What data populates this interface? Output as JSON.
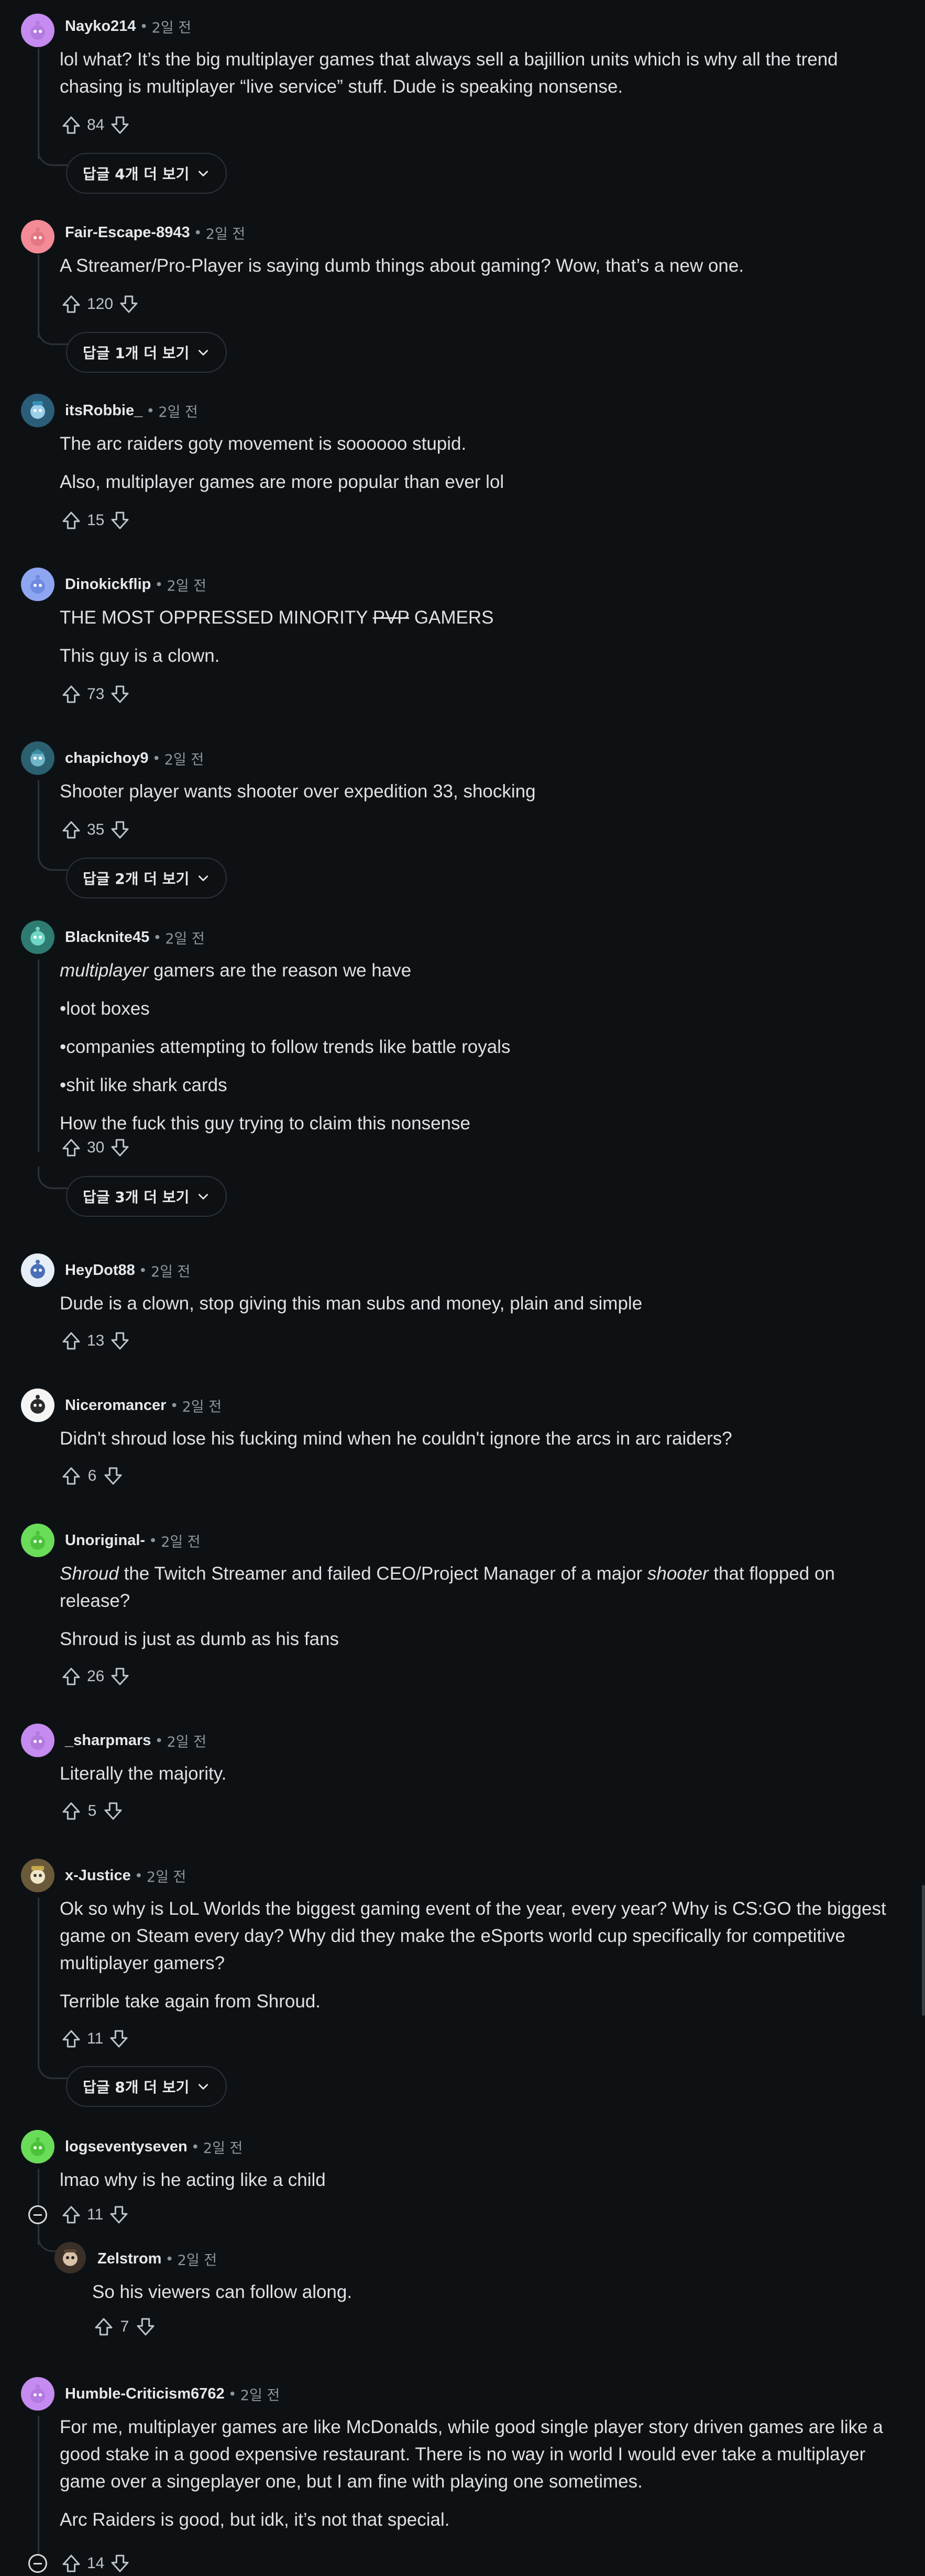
{
  "icons": {
    "upvote": "arrow-up-outline",
    "downvote": "arrow-down-outline",
    "chevron": "chevron-down",
    "collapse": "minus-circle"
  },
  "comments": [
    {
      "user": "Nayko214",
      "time": "2일 전",
      "score": "84",
      "paragraphs": [
        "lol what? It’s the big multiplayer games that always sell a bajillion units which is why all the trend chasing is multiplayer “live service” stuff. Dude is speaking nonsense."
      ],
      "more_replies": "답글 4개 더 보기",
      "avatar_color": "#c58bf0"
    },
    {
      "user": "Fair-Escape-8943",
      "time": "2일 전",
      "score": "120",
      "paragraphs": [
        "A Streamer/Pro-Player is saying dumb things about gaming? Wow, that’s a new one."
      ],
      "more_replies": "답글 1개 더 보기",
      "avatar_color": "#f28b96"
    },
    {
      "user": "itsRobbie_",
      "time": "2일 전",
      "score": "15",
      "paragraphs": [
        "The arc raiders goty movement is soooooo stupid.",
        "Also, multiplayer games are more popular than ever lol"
      ],
      "avatar_color": "#9bd0e8"
    },
    {
      "user": "Dinokickflip",
      "time": "2일 전",
      "score": "73",
      "para1_before": "THE MOST OPPRESSED MINORITY ",
      "para1_strike": "PVP",
      "para1_after": " GAMERS",
      "para2": "This guy is a clown.",
      "avatar_color": "#8ea6f2"
    },
    {
      "user": "chapichoy9",
      "time": "2일 전",
      "score": "35",
      "paragraphs": [
        "Shooter player wants shooter over expedition 33, shocking"
      ],
      "more_replies": "답글 2개 더 보기",
      "avatar_color": "#6fb6c9"
    },
    {
      "user": "Blacknite45",
      "time": "2일 전",
      "score": "30",
      "para1_em": "multiplayer",
      "para1_rest": " gamers are the reason we have",
      "paragraphs": [
        "•loot boxes",
        "•companies attempting to follow trends like battle royals",
        "•shit like shark cards",
        "How the fuck this guy trying to claim this nonsense"
      ],
      "more_replies": "답글 3개 더 보기",
      "avatar_color": "#6fd5c4"
    },
    {
      "user": "HeyDot88",
      "time": "2일 전",
      "score": "13",
      "paragraphs": [
        "Dude is a clown, stop giving this man subs and money, plain and simple"
      ],
      "avatar_color": "#e8eef8"
    },
    {
      "user": "Niceromancer",
      "time": "2일 전",
      "score": "6",
      "paragraphs": [
        "Didn't shroud lose his fucking mind when he couldn't ignore the arcs in arc raiders?"
      ],
      "avatar_color": "#f4f4f4"
    },
    {
      "user": "Unoriginal-",
      "time": "2일 전",
      "score": "26",
      "p1_em1": "Shroud",
      "p1_mid": " the Twitch Streamer and failed CEO/Project Manager of a major ",
      "p1_em2": "shooter",
      "p1_end": " that flopped on release?",
      "para2": "Shroud is just as dumb as his fans",
      "avatar_color": "#6bdc5a"
    },
    {
      "user": "_sharpmars",
      "time": "2일 전",
      "score": "5",
      "paragraphs": [
        "Literally the majority."
      ],
      "avatar_color": "#c58bf0"
    },
    {
      "user": "x-Justice",
      "time": "2일 전",
      "score": "11",
      "paragraphs": [
        "Ok so why is LoL Worlds the biggest gaming event of the year, every year? Why is CS:GO the biggest game on Steam every day? Why did they make the eSports world cup specifically for competitive multiplayer gamers?",
        "Terrible take again from Shroud."
      ],
      "more_replies": "답글 8개 더 보기",
      "avatar_color": "#f0e6c8"
    },
    {
      "user": "logseventyseven",
      "time": "2일 전",
      "score": "11",
      "paragraphs": [
        "lmao why is he acting like a child"
      ],
      "avatar_color": "#6bdc5a"
    },
    {
      "user": "Zelstrom",
      "time": "2일 전",
      "score": "7",
      "paragraphs": [
        "So his viewers can follow along."
      ],
      "avatar_color": "#d9c0a8"
    },
    {
      "user": "Humble-Criticism6762",
      "time": "2일 전",
      "score": "14",
      "paragraphs": [
        "For me, multiplayer games are like McDonalds, while good single player story driven games are like a good stake in a good expensive restaurant. There is no way in world I would ever take a multiplayer game over a singeplayer one, but I am fine with playing one sometimes.",
        "Arc Raiders is good, but idk, it’s not that special."
      ],
      "avatar_color": "#c58bf0"
    }
  ]
}
